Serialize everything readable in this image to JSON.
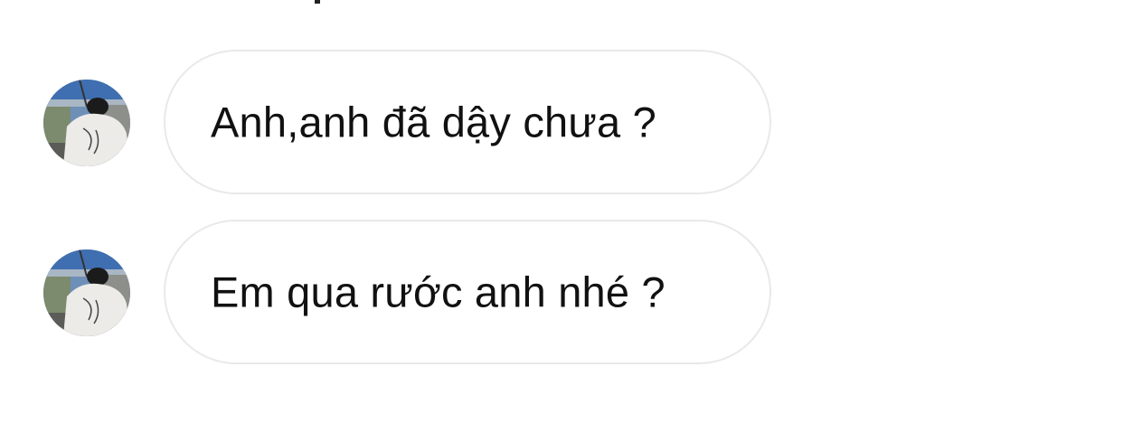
{
  "messages": [
    {
      "text": "Anh,anh đã dậy chưa ?",
      "avatar": "contact-avatar"
    },
    {
      "text": "Em qua rước anh nhé ?",
      "avatar": "contact-avatar"
    }
  ],
  "colors": {
    "bubble_border": "#e9e9e9",
    "text": "#111111",
    "background": "#ffffff"
  }
}
